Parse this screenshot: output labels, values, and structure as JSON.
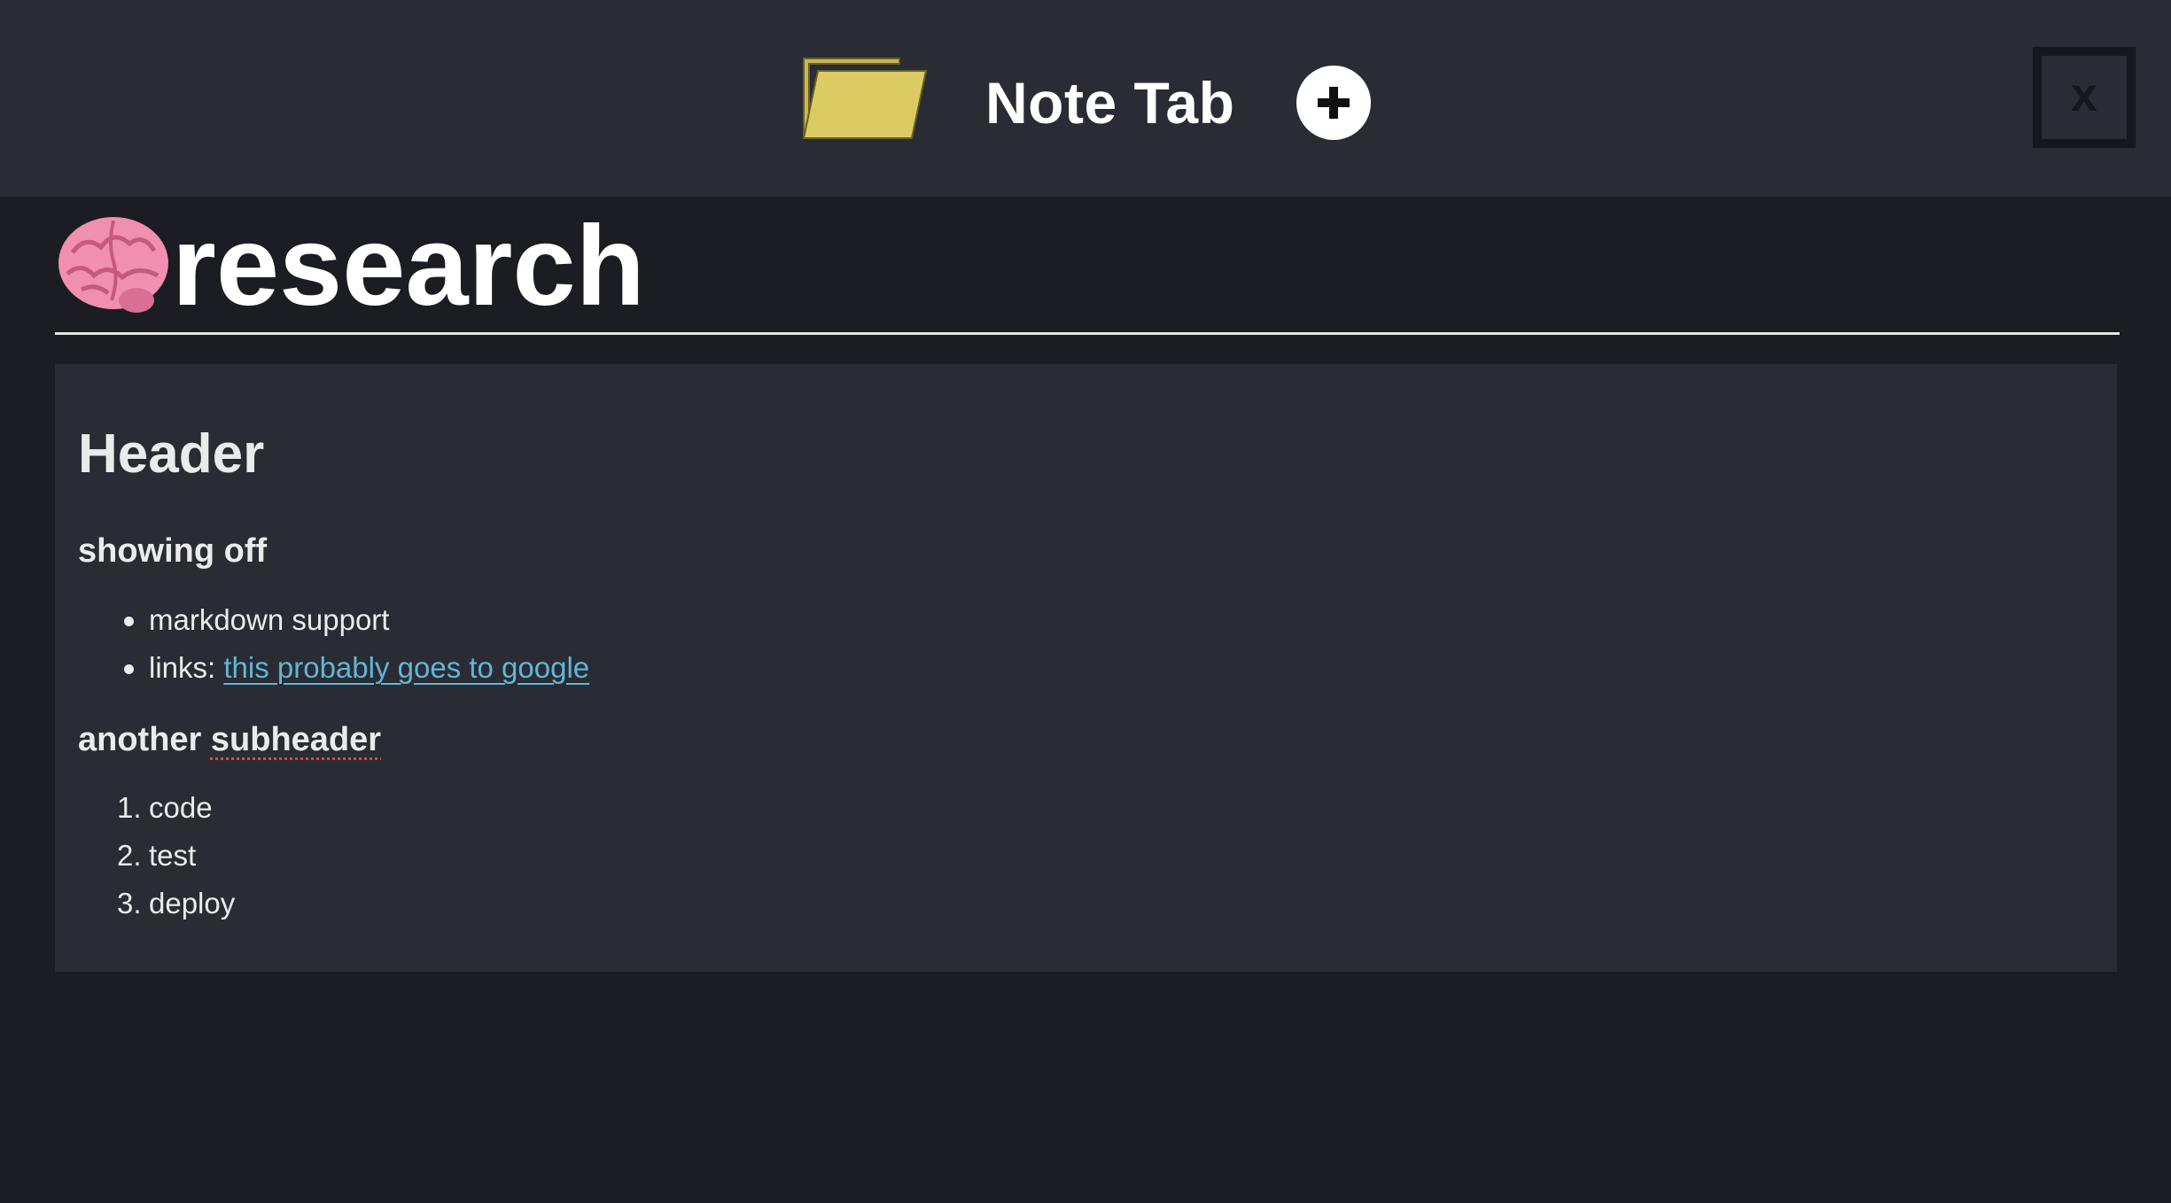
{
  "header": {
    "app_title": "Note Tab",
    "folder_icon": "folder-icon",
    "add_icon": "plus-circle-icon",
    "close_label": "x"
  },
  "note": {
    "emoji_icon": "brain-icon",
    "title": "research"
  },
  "content": {
    "h1": "Header",
    "section1_heading": "showing off",
    "bullets": [
      {
        "text": "markdown support"
      },
      {
        "prefix": "links: ",
        "link_text": "this probably goes to google"
      }
    ],
    "section2_heading_part1": "another ",
    "section2_heading_part2": "subheader",
    "ordered": [
      {
        "num": "1.",
        "text": "code"
      },
      {
        "num": "2.",
        "text": "test"
      },
      {
        "num": "3.",
        "text": "deploy"
      }
    ]
  },
  "colors": {
    "page_bg": "#1b1d23",
    "topbar_bg": "#2a2c33",
    "folder": "#dccb62",
    "link": "#62b5d8",
    "spellcheck": "#e04848"
  }
}
